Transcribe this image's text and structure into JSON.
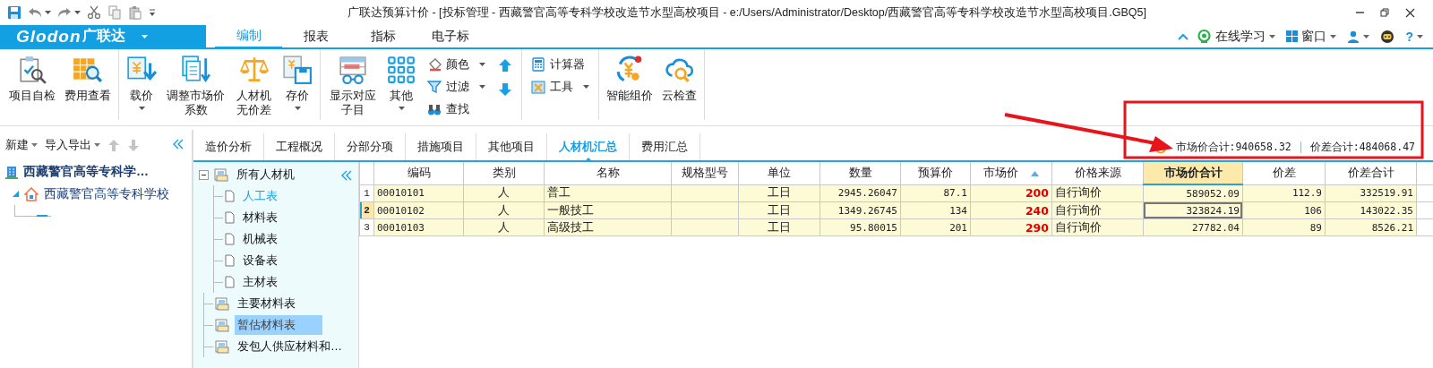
{
  "window": {
    "title": "广联达预算计价 - [投标管理 - 西藏警官高等专科学校改造节水型高校项目 - e:/Users/Administrator/Desktop/西藏警官高等专科学校改造节水型高校项目.GBQ5]"
  },
  "app_menu": {
    "brand": "Glodon",
    "brand_cn": "广联达"
  },
  "menu_tabs": [
    {
      "label": "编制",
      "selected": true
    },
    {
      "label": "报表",
      "selected": false
    },
    {
      "label": "指标",
      "selected": false
    },
    {
      "label": "电子标",
      "selected": false
    }
  ],
  "help_menu": [
    {
      "kind": "learning",
      "label": "在线学习",
      "dropdown": true
    },
    {
      "kind": "window",
      "label": "窗口",
      "dropdown": true
    },
    {
      "kind": "user",
      "dropdown": true
    },
    {
      "kind": "assistant"
    },
    {
      "kind": "help",
      "label": "?",
      "dropdown": true
    }
  ],
  "ribbon": {
    "groups": [
      {
        "items": [
          {
            "kind": "large",
            "label": "项目自检",
            "dropdown": false
          },
          {
            "kind": "large",
            "label": "费用查看",
            "dropdown": false
          }
        ]
      },
      {
        "items": [
          {
            "kind": "large",
            "label": "载价",
            "dropdown": true
          },
          {
            "kind": "large",
            "label": "调整市场价系数",
            "dropdown": false
          },
          {
            "kind": "large",
            "label": "人材机无价差",
            "dropdown": false
          },
          {
            "kind": "large",
            "label": "存价",
            "dropdown": true
          }
        ]
      },
      {
        "items": [
          {
            "kind": "large",
            "label": "显示对应子目",
            "dropdown": false
          },
          {
            "kind": "large",
            "label": "其他",
            "dropdown": true
          },
          {
            "kind": "stack",
            "items": [
              {
                "kind": "small",
                "label": "颜色",
                "dropdown": true
              },
              {
                "kind": "small",
                "label": "过滤",
                "dropdown": true
              },
              {
                "kind": "small",
                "label": "查找",
                "dropdown": false
              }
            ]
          },
          {
            "kind": "stack",
            "items": [
              {
                "kind": "icon"
              },
              {
                "kind": "icon"
              }
            ]
          }
        ]
      },
      {
        "items": [
          {
            "kind": "stack",
            "items": [
              {
                "kind": "small",
                "label": "计算器",
                "dropdown": false
              },
              {
                "kind": "small",
                "label": "工具",
                "dropdown": true
              }
            ]
          }
        ]
      },
      {
        "items": [
          {
            "kind": "large",
            "label": "智能组价",
            "dropdown": false
          },
          {
            "kind": "large",
            "label": "云检查",
            "dropdown": false
          }
        ]
      }
    ]
  },
  "project_panel": {
    "toolbar": [
      {
        "kind": "menu",
        "label": "新建",
        "dropdown": true
      },
      {
        "kind": "menu",
        "label": "导入导出",
        "dropdown": true
      },
      {
        "kind": "up",
        "disabled": true
      },
      {
        "kind": "down",
        "disabled": true
      }
    ],
    "tree": [
      {
        "label": "西藏警官高等专科学…",
        "children": [
          {
            "label": "西藏警官高等专科学校",
            "expanded": true
          }
        ]
      }
    ]
  },
  "view_tabs": [
    {
      "label": "造价分析",
      "selected": false
    },
    {
      "label": "工程概况",
      "selected": false
    },
    {
      "label": "分部分项",
      "selected": false
    },
    {
      "label": "措施项目",
      "selected": false
    },
    {
      "label": "其他项目",
      "selected": false
    },
    {
      "label": "人材机汇总",
      "selected": true
    },
    {
      "label": "费用汇总",
      "selected": false
    }
  ],
  "summary": [
    "市场价合计:940658.32",
    "价差合计:484068.47"
  ],
  "category_tree": [
    {
      "label": "所有人材机",
      "expanded": true,
      "selected": false,
      "current": false,
      "children": [
        {
          "label": "人工表",
          "selected": false,
          "current": true
        },
        {
          "label": "材料表",
          "selected": false,
          "current": false
        },
        {
          "label": "机械表",
          "selected": false,
          "current": false
        },
        {
          "label": "设备表",
          "selected": false,
          "current": false
        },
        {
          "label": "主材表",
          "selected": false,
          "current": false
        }
      ]
    },
    {
      "label": "主要材料表",
      "selected": false,
      "current": false
    },
    {
      "label": "暂估材料表",
      "selected": true,
      "current": false
    },
    {
      "label": "发包人供应材料和…",
      "selected": false,
      "current": false
    }
  ],
  "table": {
    "columns": [
      {
        "label": "编码",
        "kind": "code",
        "highlighted": false
      },
      {
        "label": "类别",
        "kind": "center",
        "highlighted": false
      },
      {
        "label": "名称",
        "kind": "text",
        "highlighted": false
      },
      {
        "label": "规格型号",
        "kind": "text",
        "highlighted": false
      },
      {
        "label": "单位",
        "kind": "center",
        "highlighted": false
      },
      {
        "label": "数量",
        "kind": "number",
        "highlighted": false
      },
      {
        "label": "预算价",
        "kind": "number",
        "highlighted": false
      },
      {
        "label": "市场价",
        "kind": "price",
        "highlighted": false,
        "sorted": true
      },
      {
        "label": "价格来源",
        "kind": "text",
        "highlighted": false
      },
      {
        "label": "市场价合计",
        "kind": "number",
        "highlighted": true
      },
      {
        "label": "价差",
        "kind": "number",
        "highlighted": false
      },
      {
        "label": "价差合计",
        "kind": "number",
        "highlighted": false
      }
    ],
    "rows": [
      {
        "number": "1",
        "selected": false,
        "cells": [
          "00010101",
          "人",
          "普工",
          null,
          "工日",
          "2945.26047",
          "87.1",
          "200",
          "自行询价",
          "589052.09",
          "112.9",
          "332519.91"
        ]
      },
      {
        "number": "2",
        "selected": true,
        "cells": [
          "00010102",
          "人",
          "一般技工",
          null,
          "工日",
          "1349.26745",
          "134",
          "240",
          "自行询价",
          "323824.19",
          "106",
          "143022.35"
        ]
      },
      {
        "number": "3",
        "selected": false,
        "cells": [
          "00010103",
          "人",
          "高级技工",
          null,
          "工日",
          "95.80015",
          "201",
          "290",
          "自行询价",
          "27782.04",
          "89",
          "8526.21"
        ]
      }
    ]
  }
}
